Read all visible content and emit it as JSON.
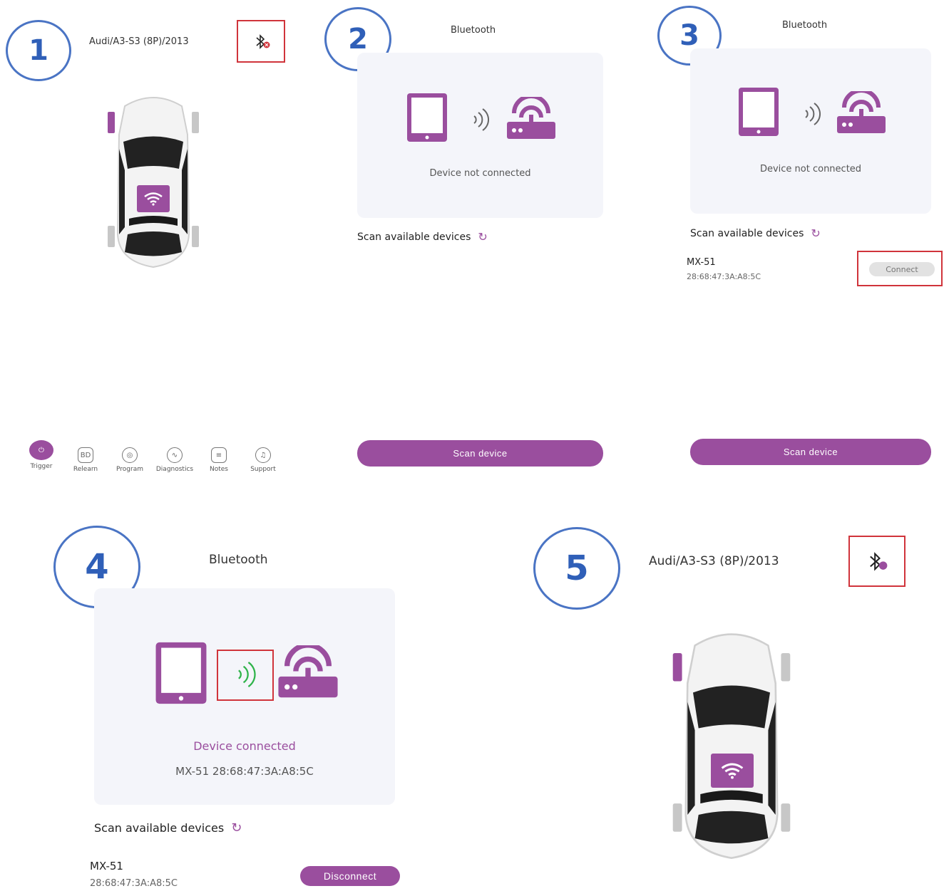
{
  "colors": {
    "accent": "#9a4e9e",
    "step_circle": "#4a74c4",
    "highlight": "#d0343b",
    "signal_connected": "#2fb34a",
    "panel_bg": "#f4f5fa"
  },
  "step1": {
    "number": "1",
    "vehicle_title": "Audi/A3-S3 (8P)/2013",
    "bluetooth_icon": "bluetooth-disconnected-icon",
    "nav": [
      {
        "label": "Trigger",
        "icon": "power-icon"
      },
      {
        "label": "Relearn",
        "icon": "obd-icon"
      },
      {
        "label": "Program",
        "icon": "sensor-icon"
      },
      {
        "label": "Diagnostics",
        "icon": "pulse-icon"
      },
      {
        "label": "Notes",
        "icon": "notes-icon"
      },
      {
        "label": "Support",
        "icon": "headset-icon"
      }
    ]
  },
  "step2": {
    "number": "2",
    "title": "Bluetooth",
    "status": "Device not connected",
    "scan_label": "Scan available devices",
    "scan_button": "Scan device"
  },
  "step3": {
    "number": "3",
    "title": "Bluetooth",
    "status": "Device not connected",
    "scan_label": "Scan available devices",
    "device_name": "MX-51",
    "device_mac": "28:68:47:3A:A8:5C",
    "connect_button": "Connect",
    "scan_button": "Scan device"
  },
  "step4": {
    "number": "4",
    "title": "Bluetooth",
    "status": "Device connected",
    "device_line": "MX-51 28:68:47:3A:A8:5C",
    "scan_label": "Scan available devices",
    "device_name": "MX-51",
    "device_mac": "28:68:47:3A:A8:5C",
    "disconnect_button": "Disconnect"
  },
  "step5": {
    "number": "5",
    "vehicle_title": "Audi/A3-S3 (8P)/2013",
    "bluetooth_icon": "bluetooth-connected-icon"
  }
}
